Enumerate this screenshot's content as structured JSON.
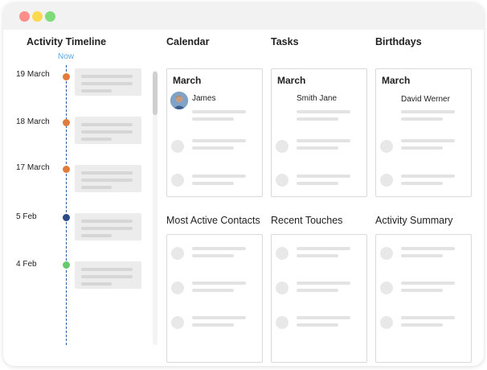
{
  "window": {
    "controls": [
      "close",
      "minimize",
      "maximize"
    ]
  },
  "timeline": {
    "title": "Activity Timeline",
    "now_label": "Now",
    "entries": [
      {
        "date": "19 March",
        "color": "#e07b3a"
      },
      {
        "date": "18 March",
        "color": "#e07b3a"
      },
      {
        "date": "17 March",
        "color": "#e07b3a"
      },
      {
        "date": "5 Feb",
        "color": "#2e4a84"
      },
      {
        "date": "4 Feb",
        "color": "#67c96d"
      }
    ]
  },
  "widgets": {
    "calendar": {
      "title": "Calendar",
      "month": "March",
      "person": "James"
    },
    "tasks": {
      "title": "Tasks",
      "month": "March",
      "person": "Smith Jane"
    },
    "birthdays": {
      "title": "Birthdays",
      "month": "March",
      "person": "David Werner"
    },
    "most_active": {
      "title": "Most Active Contacts"
    },
    "recent_touches": {
      "title": "Recent Touches"
    },
    "activity_summary": {
      "title": "Activity Summary"
    }
  }
}
